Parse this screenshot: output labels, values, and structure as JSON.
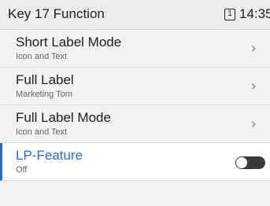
{
  "header": {
    "title": "Key 17 Function",
    "line_indicator": "1",
    "time": "14:35"
  },
  "items": [
    {
      "label": "Short Label Mode",
      "sub": "Icon and Text",
      "chevron": "›"
    },
    {
      "label": "Full Label",
      "sub": "Marketing Tom",
      "chevron": "›"
    },
    {
      "label": "Full Label Mode",
      "sub": "Icon and Text",
      "chevron": "›"
    },
    {
      "label": "LP-Feature",
      "sub": "Off",
      "toggle_on": false
    }
  ],
  "colors": {
    "accent": "#2b6cd8",
    "toggle_off": "#3a3a3a"
  }
}
